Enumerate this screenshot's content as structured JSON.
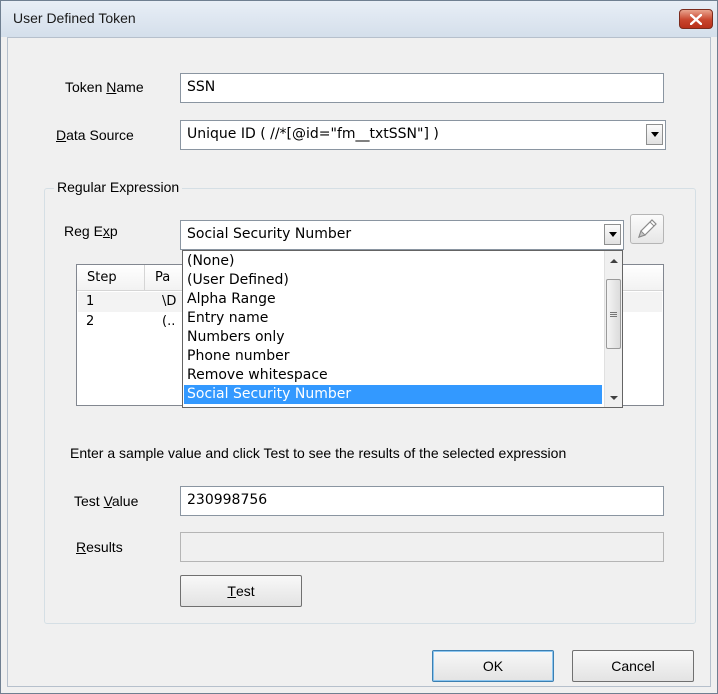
{
  "window": {
    "title": "User Defined Token"
  },
  "token_name": {
    "label_pre": "Token ",
    "label_accel": "N",
    "label_post": "ame",
    "value": "SSN"
  },
  "data_source": {
    "label_accel": "D",
    "label_post": "ata Source",
    "value": "Unique ID ( //*[@id=\"fm__txtSSN\"] )"
  },
  "regex_group": {
    "label": "Regular Expression",
    "regexp_label_pre": "Reg E",
    "regexp_label_accel": "x",
    "regexp_label_post": "p",
    "regexp_value": "Social Security Number",
    "dropdown_options": [
      "(None)",
      "(User Defined)",
      "Alpha Range",
      "Entry name",
      "Numbers only",
      "Phone number",
      "Remove whitespace",
      "Social Security Number"
    ],
    "selected_index": 7,
    "steps_table": {
      "columns": [
        "Step",
        "Pa"
      ],
      "rows": [
        {
          "step": "1",
          "pattern": "\\D"
        },
        {
          "step": "2",
          "pattern": "(.."
        }
      ]
    },
    "instructions": "Enter a sample value and click Test to see the results of the selected expression",
    "test_value": {
      "label_pre": "Test ",
      "label_accel": "V",
      "label_post": "alue",
      "value": "230998756"
    },
    "results": {
      "label_accel": "R",
      "label_post": "esults",
      "value": ""
    },
    "test_button": {
      "accel": "T",
      "post": "est"
    }
  },
  "footer": {
    "ok_label": "OK",
    "cancel_label": "Cancel"
  },
  "icons": [
    "close-icon",
    "chevron-down-icon",
    "pencil-icon",
    "scroll-up-icon",
    "scroll-down-icon"
  ]
}
